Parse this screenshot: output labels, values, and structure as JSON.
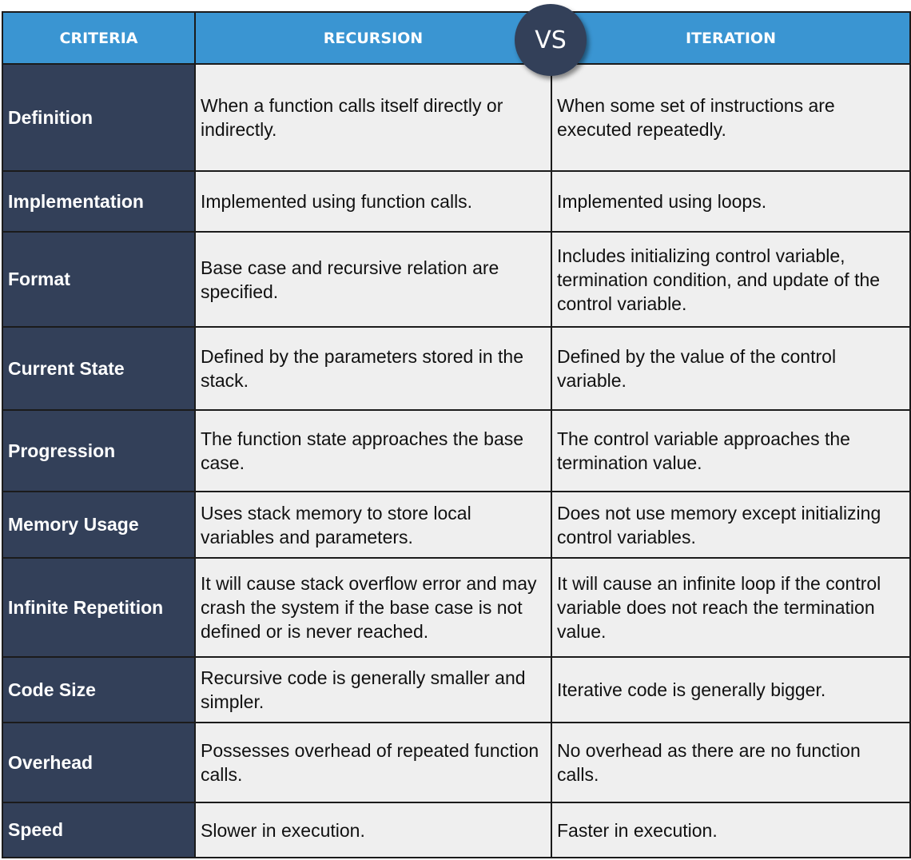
{
  "header": {
    "criteria": "CRITERIA",
    "recursion": "RECURSION",
    "iteration": "ITERATION",
    "vs_badge": "VS"
  },
  "colors": {
    "header_bg": "#3a95d2",
    "criteria_bg": "#334059",
    "cell_bg": "#efefef",
    "border": "#1b1b1b"
  },
  "rows": [
    {
      "criteria": "Definition",
      "recursion": "When a function calls itself directly or indirectly.",
      "iteration": "When some set of instructions are executed repeatedly."
    },
    {
      "criteria": "Implementation",
      "recursion": "Implemented using function calls.",
      "iteration": "Implemented using loops."
    },
    {
      "criteria": "Format",
      "recursion": "Base case and recursive relation are specified.",
      "iteration": "Includes initializing control variable, termination condition, and update of the control variable."
    },
    {
      "criteria": "Current State",
      "recursion": "Defined by the parameters stored in the stack.",
      "iteration": "Defined by the value of the control variable."
    },
    {
      "criteria": "Progression",
      "recursion": "The function state approaches the base case.",
      "iteration": "The control variable approaches the termination value."
    },
    {
      "criteria": "Memory Usage",
      "recursion": "Uses stack memory to store local variables and parameters.",
      "iteration": "Does not use memory except initializing control variables."
    },
    {
      "criteria": "Infinite Repetition",
      "recursion": "It will cause stack overflow error and may crash the system if the base case is not defined or is never reached.",
      "iteration": "It will cause an infinite loop if the control variable does not reach the termination value."
    },
    {
      "criteria": "Code Size",
      "recursion": "Recursive code is generally smaller and simpler.",
      "iteration": "Iterative code is generally bigger."
    },
    {
      "criteria": "Overhead",
      "recursion": "Possesses overhead of repeated function calls.",
      "iteration": "No overhead as there are no function calls."
    },
    {
      "criteria": "Speed",
      "recursion": "Slower in execution.",
      "iteration": "Faster in execution."
    }
  ]
}
